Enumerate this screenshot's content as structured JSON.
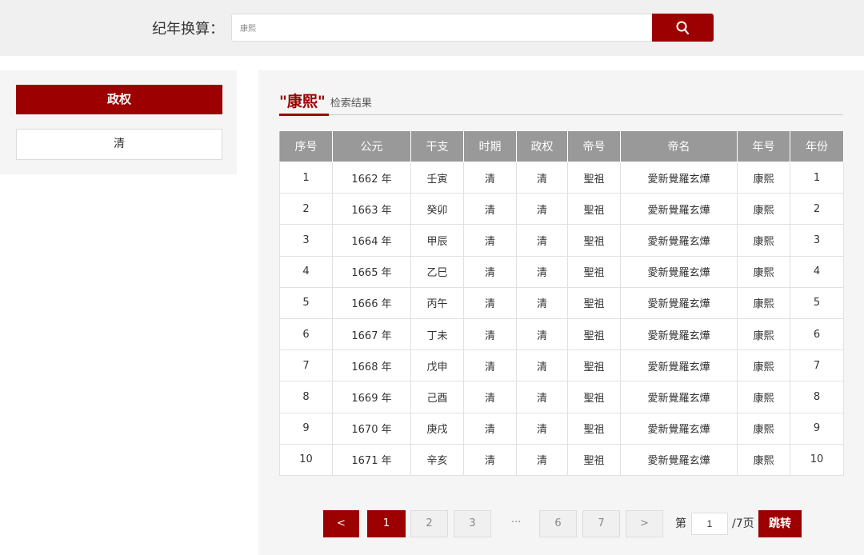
{
  "search": {
    "label": "纪年换算：",
    "value": "康熙"
  },
  "sidebar": {
    "heading": "政权",
    "items": [
      {
        "label": "清"
      }
    ]
  },
  "results": {
    "keyword": "\"康熙\"",
    "suffix": "检索结果",
    "columns": [
      "序号",
      "公元",
      "干支",
      "时期",
      "政权",
      "帝号",
      "帝名",
      "年号",
      "年份"
    ],
    "rows": [
      [
        "1",
        "1662 年",
        "壬寅",
        "清",
        "清",
        "聖祖",
        "愛新覺羅玄燁",
        "康熙",
        "1"
      ],
      [
        "2",
        "1663 年",
        "癸卯",
        "清",
        "清",
        "聖祖",
        "愛新覺羅玄燁",
        "康熙",
        "2"
      ],
      [
        "3",
        "1664 年",
        "甲辰",
        "清",
        "清",
        "聖祖",
        "愛新覺羅玄燁",
        "康熙",
        "3"
      ],
      [
        "4",
        "1665 年",
        "乙巳",
        "清",
        "清",
        "聖祖",
        "愛新覺羅玄燁",
        "康熙",
        "4"
      ],
      [
        "5",
        "1666 年",
        "丙午",
        "清",
        "清",
        "聖祖",
        "愛新覺羅玄燁",
        "康熙",
        "5"
      ],
      [
        "6",
        "1667 年",
        "丁未",
        "清",
        "清",
        "聖祖",
        "愛新覺羅玄燁",
        "康熙",
        "6"
      ],
      [
        "7",
        "1668 年",
        "戊申",
        "清",
        "清",
        "聖祖",
        "愛新覺羅玄燁",
        "康熙",
        "7"
      ],
      [
        "8",
        "1669 年",
        "己酉",
        "清",
        "清",
        "聖祖",
        "愛新覺羅玄燁",
        "康熙",
        "8"
      ],
      [
        "9",
        "1670 年",
        "庚戌",
        "清",
        "清",
        "聖祖",
        "愛新覺羅玄燁",
        "康熙",
        "9"
      ],
      [
        "10",
        "1671 年",
        "辛亥",
        "清",
        "清",
        "聖祖",
        "愛新覺羅玄燁",
        "康熙",
        "10"
      ]
    ]
  },
  "pagination": {
    "prev": "<",
    "pages": [
      "1",
      "2",
      "3"
    ],
    "ellipsis": "···",
    "tail_pages": [
      "6",
      "7"
    ],
    "next": ">",
    "current_page": 1,
    "page_prefix": "第",
    "page_input": "1",
    "page_suffix": "/7页",
    "jump": "跳转"
  },
  "colors": {
    "accent": "#9c0000",
    "header_bg": "#999999",
    "panel_bg": "#f5f5f5"
  },
  "icons": {
    "search_button": "search-icon"
  }
}
